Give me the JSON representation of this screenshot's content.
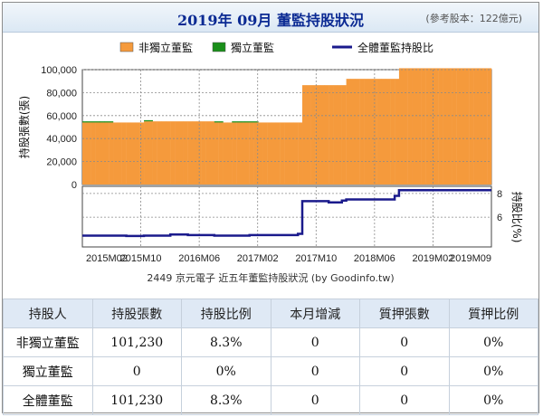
{
  "header": {
    "title": "2019年 09月 董監持股狀況",
    "reference": "(參考股本：122億元)"
  },
  "legend": {
    "items": [
      {
        "label": "非獨立董監",
        "color": "#f59a3c"
      },
      {
        "label": "獨立董監",
        "color": "#1a8f1a"
      },
      {
        "label": "全體董監持股比",
        "color": "#1a1a8c"
      }
    ]
  },
  "chart_data": {
    "type": "bar",
    "caption": "2449 京元電子 近五年董監持股狀況 (by Goodinfo.tw)",
    "ylabel_left": "持股張數(張)",
    "ylabel_right": "持股比(%)",
    "ylim_left": [
      0,
      100000
    ],
    "yticks_left": [
      "100,000",
      "80,000",
      "60,000",
      "40,000",
      "20,000",
      "0"
    ],
    "yticks_right": [
      "8",
      "6"
    ],
    "ylim_right_approx": [
      3.5,
      8.6
    ],
    "xticks": [
      "2015M02",
      "2015M10",
      "2016M06",
      "2017M02",
      "2017M10",
      "2018M06",
      "2019M02",
      "2019M09"
    ],
    "grid": true,
    "series": [
      {
        "name": "非獨立董監",
        "color": "#f59a3c",
        "values": [
          54000,
          54000,
          54000,
          54000,
          54000,
          54000,
          54000,
          54000,
          54000,
          54000,
          54000,
          54000,
          54000,
          54000,
          55000,
          55000,
          55000,
          55000,
          55000,
          55000,
          55000,
          55000,
          55000,
          55000,
          55000,
          55000,
          55000,
          55000,
          55000,
          55000,
          54000,
          54000,
          54000,
          54000,
          54000,
          54000,
          54000,
          54000,
          54000,
          54000,
          54000,
          54000,
          54000,
          54000,
          54000,
          54000,
          54000,
          54000,
          54000,
          54000,
          86500,
          86500,
          86500,
          86500,
          86500,
          86500,
          86500,
          86500,
          86500,
          86500,
          92000,
          92000,
          92000,
          92000,
          92000,
          92000,
          92000,
          92000,
          92000,
          92000,
          92000,
          92000,
          101230,
          101230,
          101230,
          101230,
          101230,
          101230,
          101230,
          101230,
          101230,
          101230,
          101230,
          101230,
          101230,
          101230,
          101230,
          101230,
          101230,
          101230,
          101230,
          101230,
          101230
        ]
      },
      {
        "name": "獨立董監",
        "color": "#1a8f1a",
        "values": [
          1000,
          1000,
          1000,
          1000,
          1000,
          1000,
          1000,
          0,
          0,
          0,
          0,
          0,
          0,
          0,
          1000,
          1000,
          0,
          0,
          0,
          0,
          0,
          0,
          0,
          0,
          0,
          0,
          0,
          0,
          0,
          0,
          1000,
          1000,
          0,
          0,
          1000,
          1000,
          1000,
          1000,
          1000,
          1000,
          0,
          0,
          0,
          0,
          0,
          0,
          0,
          0,
          0,
          0,
          0,
          0,
          0,
          0,
          0,
          0,
          0,
          0,
          0,
          0,
          0,
          0,
          0,
          0,
          0,
          0,
          0,
          0,
          0,
          0,
          0,
          0,
          0,
          0,
          0,
          0,
          0,
          0,
          0,
          0,
          0,
          0,
          0,
          0,
          0,
          0,
          0,
          0,
          0,
          0,
          0,
          0,
          0
        ]
      },
      {
        "name": "全體董監持股比",
        "color": "#1a1a8c",
        "values": [
          4.45,
          4.45,
          4.45,
          4.45,
          4.45,
          4.45,
          4.45,
          4.45,
          4.45,
          4.45,
          4.42,
          4.42,
          4.42,
          4.42,
          4.45,
          4.45,
          4.45,
          4.45,
          4.45,
          4.45,
          4.55,
          4.55,
          4.55,
          4.55,
          4.5,
          4.5,
          4.5,
          4.5,
          4.5,
          4.5,
          4.45,
          4.45,
          4.45,
          4.45,
          4.45,
          4.45,
          4.45,
          4.45,
          4.5,
          4.5,
          4.5,
          4.5,
          4.5,
          4.5,
          4.5,
          4.5,
          4.5,
          4.5,
          4.5,
          4.6,
          7.35,
          7.35,
          7.35,
          7.35,
          7.35,
          7.35,
          7.25,
          7.25,
          7.25,
          7.4,
          7.5,
          7.5,
          7.5,
          7.5,
          7.5,
          7.5,
          7.5,
          7.5,
          7.5,
          7.5,
          7.5,
          7.8,
          8.28,
          8.28,
          8.28,
          8.28,
          8.28,
          8.28,
          8.28,
          8.28,
          8.28,
          8.28,
          8.28,
          8.28,
          8.28,
          8.28,
          8.28,
          8.28,
          8.28,
          8.28,
          8.28,
          8.28,
          8.28
        ]
      }
    ]
  },
  "table": {
    "headers": [
      "持股人",
      "持股張數",
      "持股比例",
      "本月增減",
      "質押張數",
      "質押比例"
    ],
    "rows": [
      [
        "非獨立董監",
        "101,230",
        "8.3%",
        "0",
        "0",
        "0%"
      ],
      [
        "獨立董監",
        "0",
        "0%",
        "0",
        "0",
        "0%"
      ],
      [
        "全體董監",
        "101,230",
        "8.3%",
        "0",
        "0",
        "0%"
      ]
    ]
  }
}
